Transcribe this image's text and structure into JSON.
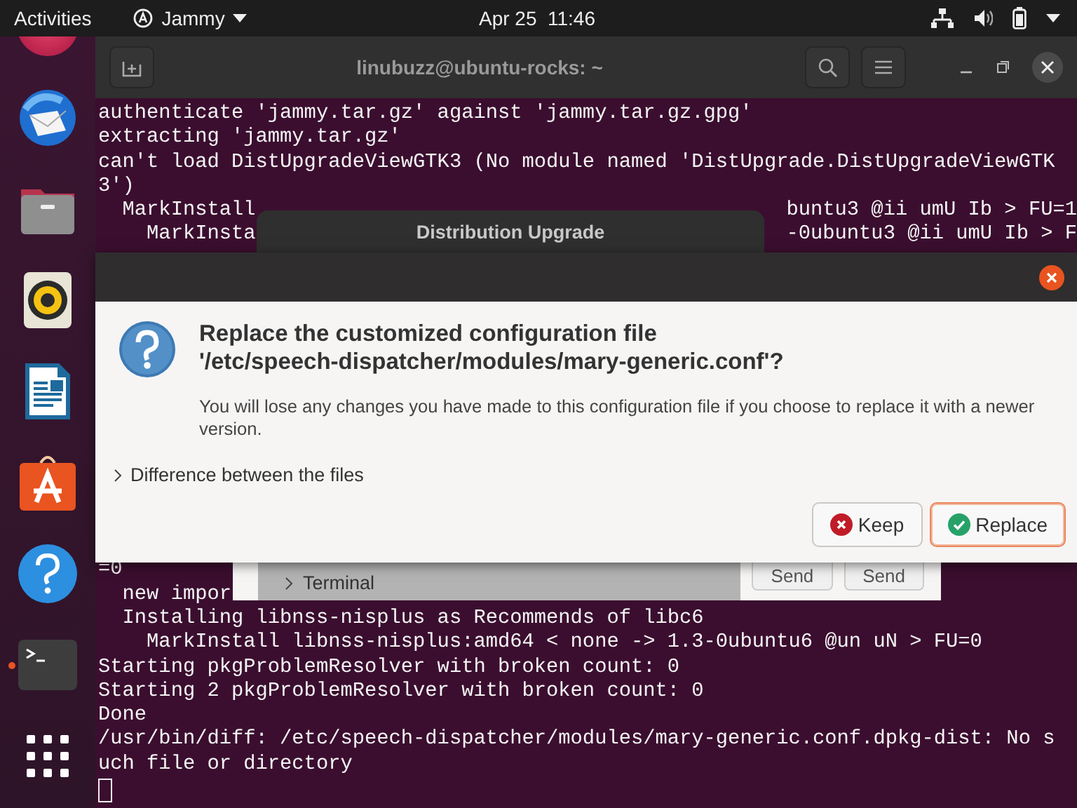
{
  "top_bar": {
    "activities": "Activities",
    "app_menu": "Jammy",
    "clock": "Apr 25  11:46"
  },
  "dock": {
    "items": [
      {
        "kind": "mail",
        "running": false
      },
      {
        "kind": "files",
        "running": false
      },
      {
        "kind": "music",
        "running": false
      },
      {
        "kind": "writer",
        "running": false
      },
      {
        "kind": "store",
        "running": false
      },
      {
        "kind": "help",
        "running": false
      },
      {
        "kind": "terminal",
        "running": true
      },
      {
        "kind": "apps",
        "running": false
      }
    ]
  },
  "terminal": {
    "title": "linubuzz@ubuntu-rocks: ~",
    "lines_top": [
      [
        "authenticate 'jammy.tar.gz' against 'jammy.tar.gz.gpg'"
      ],
      [
        "extracting 'jammy.tar.gz'"
      ],
      [
        "can't load DistUpgradeViewGTK3 (No module named 'DistUpgrade.DistUpgradeViewGTK"
      ],
      [
        "3')"
      ],
      [
        "  MarkInstall",
        "buntu3 @ii umU Ib > FU=1"
      ],
      [
        "    MarkInsta",
        "-0ubuntu3 @ii umU Ib > F"
      ]
    ],
    "lines_bottom": [
      [
        "=0"
      ],
      [
        "  new impor"
      ],
      [
        "  Installing libnss-nisplus as Recommends of libc6"
      ],
      [
        "    MarkInstall libnss-nisplus:amd64 < none -> 1.3-0ubuntu6 @un uN > FU=0"
      ],
      [
        "Starting pkgProblemResolver with broken count: 0"
      ],
      [
        "Starting 2 pkgProblemResolver with broken count: 0"
      ],
      [
        "Done"
      ],
      [
        "/usr/bin/diff: /etc/speech-dispatcher/modules/mary-generic.conf.dpkg-dist: No s"
      ],
      [
        "uch file or directory"
      ]
    ]
  },
  "upgrade_window": {
    "title": "Distribution Upgrade",
    "terminal_expander": {
      "label": "Terminal",
      "expanded": false
    },
    "buttons": [
      "Send",
      "Send"
    ]
  },
  "dialog": {
    "heading": "Replace the customized configuration file\n'/etc/speech-dispatcher/modules/mary-generic.conf'?",
    "message": "You will lose any changes you have made to this configuration file if you choose to replace it with a newer version.",
    "expander": {
      "label": "Difference between the files",
      "expanded": false
    },
    "buttons": [
      {
        "label": "Keep",
        "kind": "cancel",
        "focused": false
      },
      {
        "label": "Replace",
        "kind": "confirm",
        "focused": true
      }
    ]
  }
}
